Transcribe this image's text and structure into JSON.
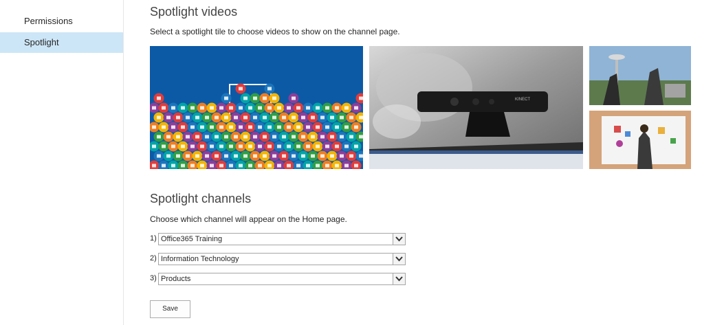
{
  "sidebar": {
    "items": [
      {
        "label": "Permissions",
        "active": false
      },
      {
        "label": "Spotlight",
        "active": true
      }
    ]
  },
  "spotlight_videos": {
    "title": "Spotlight videos",
    "description": "Select a spotlight tile to choose videos to show on the channel page."
  },
  "spotlight_channels": {
    "title": "Spotlight channels",
    "description": "Choose which channel will appear on the Home page.",
    "rows": [
      {
        "number": "1)",
        "value": "Office365 Training"
      },
      {
        "number": "2)",
        "value": "Information Technology"
      },
      {
        "number": "3)",
        "value": "Products"
      }
    ]
  },
  "tiles": {
    "kinect_label": "KINECT"
  },
  "save_label": "Save",
  "colors": {
    "sidebar_active": "#cde6f7",
    "tile_blue": "#0c5aa6"
  }
}
